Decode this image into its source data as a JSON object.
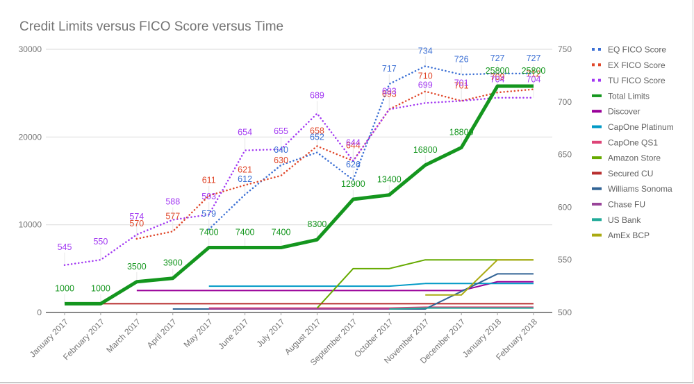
{
  "chart_data": {
    "type": "line",
    "title": "Credit Limits versus FICO Score versus Time",
    "xlabel": "",
    "ylabel": "",
    "y2label": "",
    "categories": [
      "January 2017",
      "February 2017",
      "March 2017",
      "April 2017",
      "May 2017",
      "June 2017",
      "July 2017",
      "August 2017",
      "September 2017",
      "October 2017",
      "November 2017",
      "December 2017",
      "January 2018",
      "February 2018"
    ],
    "ylim": [
      0,
      30000
    ],
    "y_ticks": [
      "0",
      "10000",
      "20000",
      "30000"
    ],
    "y2lim": [
      500,
      750
    ],
    "y2_ticks": [
      "500",
      "550",
      "600",
      "650",
      "700",
      "750"
    ],
    "grid": true,
    "legend_position": "right",
    "series": [
      {
        "name": "EQ FICO Score",
        "axis": "right",
        "style": "dotted",
        "color": "#3b6fd4",
        "labels": true,
        "values": [
          null,
          null,
          null,
          null,
          579,
          612,
          640,
          652,
          626,
          717,
          734,
          726,
          727,
          727
        ]
      },
      {
        "name": "EX FICO Score",
        "axis": "right",
        "style": "dotted",
        "color": "#e0472a",
        "labels": true,
        "values": [
          null,
          null,
          570,
          577,
          611,
          621,
          630,
          658,
          644,
          693,
          710,
          701,
          709,
          712
        ]
      },
      {
        "name": "TU FICO Score",
        "axis": "right",
        "style": "dotted",
        "color": "#a238f2",
        "labels": true,
        "values": [
          545,
          550,
          574,
          588,
          593,
          654,
          655,
          689,
          644,
          693,
          699,
          701,
          704,
          704
        ]
      },
      {
        "name": "Total Limits",
        "axis": "left",
        "style": "thick",
        "color": "#14961e",
        "labels": true,
        "values": [
          1000,
          1000,
          3500,
          3900,
          7400,
          7400,
          7400,
          8300,
          12900,
          13400,
          16800,
          18800,
          25800,
          25800
        ]
      },
      {
        "name": "Discover",
        "axis": "left",
        "style": "solid",
        "color": "#990099",
        "values": [
          null,
          null,
          2500,
          2500,
          2500,
          2500,
          2500,
          2500,
          2500,
          2500,
          2500,
          2500,
          3500,
          3500
        ]
      },
      {
        "name": "CapOne Platinum",
        "axis": "left",
        "style": "solid",
        "color": "#0099c6",
        "values": [
          null,
          null,
          null,
          null,
          3000,
          3000,
          3000,
          3000,
          3000,
          3000,
          3300,
          3300,
          3300,
          3300
        ]
      },
      {
        "name": "CapOne QS1",
        "axis": "left",
        "style": "solid",
        "color": "#dd4477",
        "values": [
          null,
          null,
          null,
          null,
          500,
          500,
          500,
          500,
          500,
          500,
          600,
          600,
          600,
          600
        ]
      },
      {
        "name": "Amazon Store",
        "axis": "left",
        "style": "solid",
        "color": "#66aa00",
        "values": [
          null,
          null,
          null,
          null,
          null,
          null,
          null,
          500,
          5000,
          5000,
          6000,
          6000,
          6000,
          6000
        ]
      },
      {
        "name": "Secured CU",
        "axis": "left",
        "style": "solid",
        "color": "#b82e2e",
        "values": [
          1000,
          1000,
          1000,
          1000,
          1000,
          1000,
          1000,
          1000,
          1000,
          1000,
          1000,
          1000,
          1000,
          1000
        ]
      },
      {
        "name": "Williams Sonoma",
        "axis": "left",
        "style": "solid",
        "color": "#316395",
        "values": [
          null,
          null,
          null,
          400,
          400,
          400,
          400,
          400,
          400,
          400,
          400,
          2400,
          4400,
          4400
        ]
      },
      {
        "name": "Chase FU",
        "axis": "left",
        "style": "solid",
        "color": "#994499",
        "values": [
          null,
          null,
          null,
          null,
          400,
          400,
          400,
          400,
          400,
          400,
          null,
          null,
          null,
          null
        ]
      },
      {
        "name": "US Bank",
        "axis": "left",
        "style": "solid",
        "color": "#22aa99",
        "values": [
          null,
          null,
          null,
          null,
          null,
          null,
          null,
          null,
          null,
          400,
          500,
          500,
          500,
          500
        ]
      },
      {
        "name": "AmEx BCP",
        "axis": "left",
        "style": "solid",
        "color": "#aaaa11",
        "values": [
          null,
          null,
          null,
          null,
          null,
          null,
          null,
          null,
          null,
          null,
          2000,
          2000,
          6000,
          6000
        ]
      }
    ]
  }
}
